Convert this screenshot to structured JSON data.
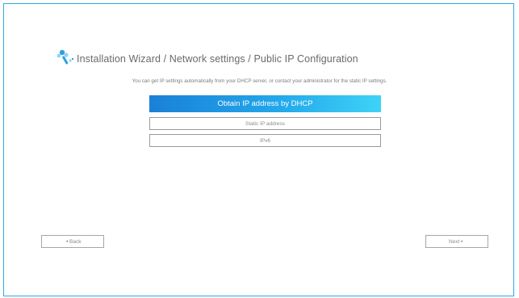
{
  "header": {
    "logo_icon": "wifi-tools-logo-icon",
    "title": "Installation Wizard / Network settings / Public IP Configuration"
  },
  "description": "You can get IP settings automatically from your DHCP server, or contact your administrator for the static IP settings.",
  "options": {
    "dhcp_label": "Obtain IP address by DHCP",
    "static_label": "Static IP address",
    "ipv6_label": "IPv6",
    "selected": "dhcp"
  },
  "nav": {
    "back_label": "Back",
    "back_icon": "◂",
    "next_label": "Next",
    "next_icon": "▸"
  },
  "colors": {
    "frame_border": "#35a7e6",
    "primary_gradient_start": "#1b80d8",
    "primary_gradient_end": "#3fd3f7",
    "logo_blue": "#2f9fe0",
    "logo_light": "#8ed4f5"
  }
}
